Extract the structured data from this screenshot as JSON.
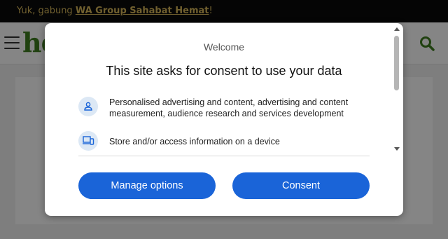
{
  "topbar": {
    "prefix": "Yuk, gabung ",
    "link": "WA Group Sahabat Hemat",
    "suffix": "!"
  },
  "header": {
    "logo_text": "he",
    "menu_icon": "hamburger-menu-icon",
    "search_icon": "search-icon",
    "brand_color": "#3f7d1f"
  },
  "dialog": {
    "welcome": "Welcome",
    "heading": "This site asks for consent to use your data",
    "purposes": [
      {
        "icon": "person-icon",
        "text": "Personalised advertising and content, advertising and content measurement, audience research and services development"
      },
      {
        "icon": "devices-icon",
        "text": "Store and/or access information on a device"
      }
    ],
    "buttons": {
      "manage": "Manage options",
      "consent": "Consent"
    },
    "accent_color": "#1a64d8"
  }
}
